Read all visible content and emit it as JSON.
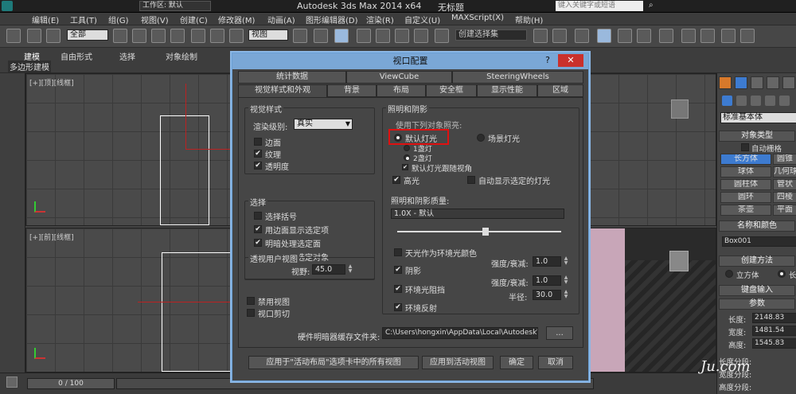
{
  "titlebar": {
    "workspace_label": "工作区: 默认",
    "app_title": "Autodesk 3ds Max  2014 x64",
    "doc_title": "无标题",
    "search_placeholder": "键入关键字或短语"
  },
  "menu": [
    "编辑(E)",
    "工具(T)",
    "组(G)",
    "视图(V)",
    "创建(C)",
    "修改器(M)",
    "动画(A)",
    "图形编辑器(D)",
    "渲染(R)",
    "自定义(U)",
    "MAXScript(X)",
    "帮助(H)"
  ],
  "toolbar": {
    "filter_value": "全部",
    "view_value": "视图",
    "selset_value": "创建选择集"
  },
  "ribbon": {
    "tabs": [
      "建模",
      "自由形式",
      "选择",
      "对象绘制"
    ],
    "sub": "多边形建模"
  },
  "viewports": {
    "top_label": "[+][顶][线框]",
    "front_label": "[+][前][线框]"
  },
  "dialog": {
    "title": "视口配置",
    "help": "?",
    "close": "✕",
    "tabs_row1": [
      "统计数据",
      "ViewCube",
      "SteeringWheels"
    ],
    "tabs_row2": [
      "视觉样式和外观",
      "背景",
      "布局",
      "安全框",
      "显示性能",
      "区域"
    ],
    "visual_style": {
      "title": "视觉样式",
      "render_level_label": "渲染级别:",
      "render_level_value": "真实",
      "edge_faces": "边面",
      "textures": "纹理",
      "transparency": "透明度"
    },
    "selection": {
      "title": "选择",
      "sel_brackets": "选择括号",
      "edge_faces_selected": "用边面显示选定项",
      "shade_selected_faces": "明暗处理选定面",
      "shade_selected_objects": "明暗处理选定对象"
    },
    "perspective": {
      "title": "透视用户视图",
      "fov_label": "视野:",
      "fov_value": "45.0"
    },
    "disable_view": "禁用视图",
    "viewport_clip": "视口剪切",
    "lighting": {
      "title": "照明和阴影",
      "use_following": "使用下列对象照亮:",
      "default_lights": "默认灯光",
      "scene_lights": "场景灯光",
      "one_light": "1盏灯",
      "two_lights": "2盏灯",
      "follow_view": "默认灯光跟随视角",
      "highlights": "高光",
      "auto_display_selected": "自动显示选定的灯光",
      "quality_label": "照明和阴影质量:",
      "quality_value": "1.0X - 默认",
      "skylight_ambient": "天光作为环境光颜色",
      "shadows": "阴影",
      "ao": "环境光阻挡",
      "reflections": "环境反射",
      "intensity_label": "强度/衰减:",
      "shadow_intensity": "1.0",
      "ao_intensity": "1.0",
      "radius_label": "半径:",
      "radius_value": "30.0",
      "quality_fraction": 0.54
    },
    "cache": {
      "label": "硬件明暗器缓存文件夹:",
      "path": "C:\\Users\\hongxin\\AppData\\Local\\Autodesk\\3dsMax\\",
      "browse": "..."
    },
    "buttons": {
      "apply_all": "应用于\"活动布局\"选项卡中的所有视图",
      "apply_active": "应用到活动视图",
      "ok": "确定",
      "cancel": "取消"
    }
  },
  "cmdpanel": {
    "dropdown": "标准基本体",
    "object_type": "对象类型",
    "auto_grid": "自动栅格",
    "items": [
      "长方体",
      "圆锥",
      "球体",
      "几何球",
      "圆柱体",
      "管状",
      "圆环",
      "四棱",
      "茶壶",
      "平面"
    ],
    "name_color": "名称和颜色",
    "name_value": "Box001",
    "create_method": "创建方法",
    "cube": "立方体",
    "longbox": "长方",
    "keyboard_input": "键盘输入",
    "params": "参数",
    "length": "长度:",
    "length_val": "2148.83",
    "width": "宽度:",
    "width_val": "1481.54",
    "height": "高度:",
    "height_val": "1545.83",
    "len_segs": "长度分段:",
    "wid_segs": "宽度分段:",
    "hgt_segs": "高度分段:"
  },
  "statusbar": {
    "frame": "0 / 100"
  },
  "watermark": "Ju.com",
  "colors": {
    "dialog_title": "#7aa7d6",
    "highlight_box": "#e01010",
    "active_cmd": "#3d7bd0"
  }
}
